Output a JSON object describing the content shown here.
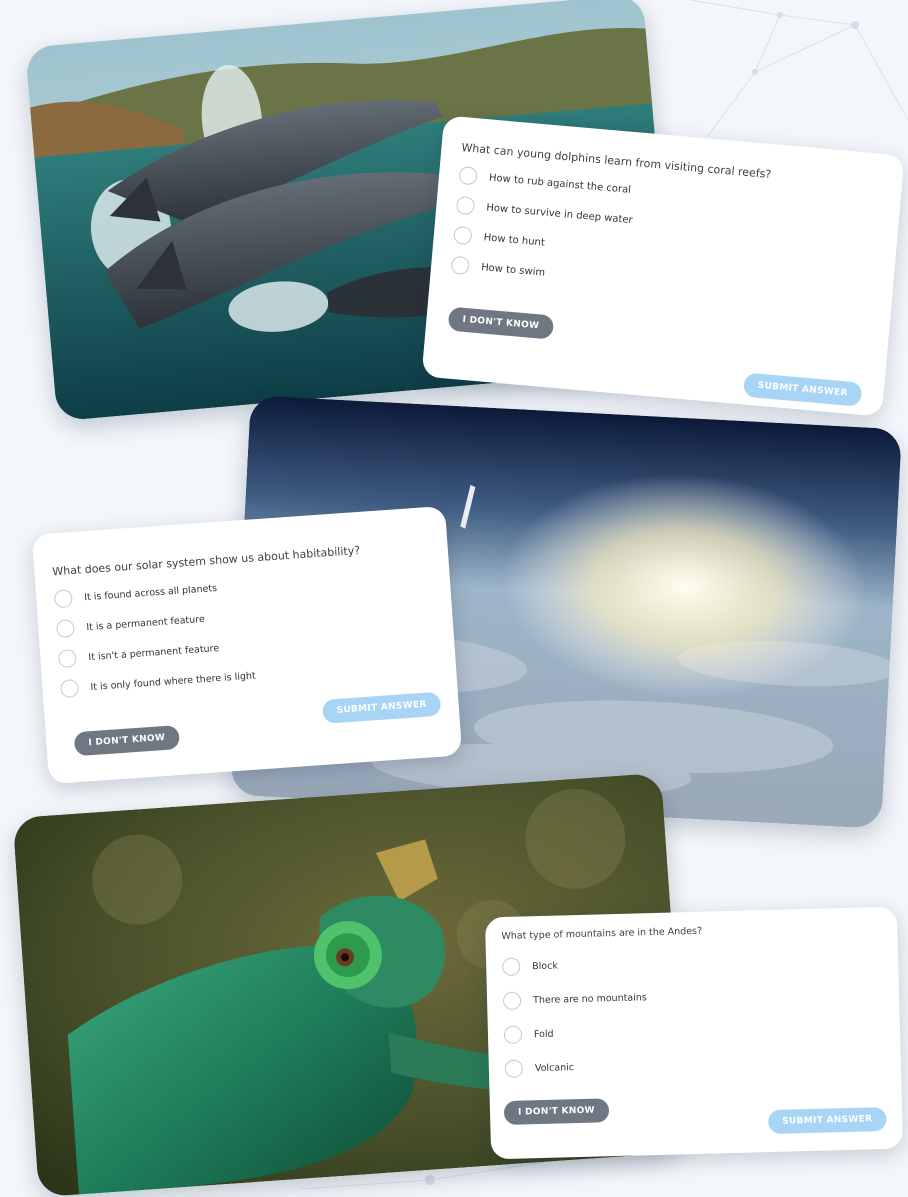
{
  "quizzes": [
    {
      "question": "What can young dolphins learn from visiting coral reefs?",
      "options": [
        "How to rub against the coral",
        "How to survive in deep water",
        "How to hunt",
        "How to swim"
      ],
      "idk_label": "I DON'T KNOW",
      "submit_label": "SUBMIT ANSWER"
    },
    {
      "question": "What does our solar system show us about habitability?",
      "options": [
        "It is found across all planets",
        "It is a permanent feature",
        "It isn't a permanent feature",
        "It is only found where there is light"
      ],
      "idk_label": "I DON'T KNOW",
      "submit_label": "SUBMIT ANSWER"
    },
    {
      "question": "What type of mountains are in the Andes?",
      "options": [
        "Block",
        "There are no mountains",
        "Fold",
        "Volcanic"
      ],
      "idk_label": "I DON'T KNOW",
      "submit_label": "SUBMIT ANSWER"
    }
  ],
  "colors": {
    "background": "#f3f6fa",
    "idk_button": "#6f7782",
    "submit_button": "#a8d4f6",
    "radio_border": "#c4cad3"
  }
}
